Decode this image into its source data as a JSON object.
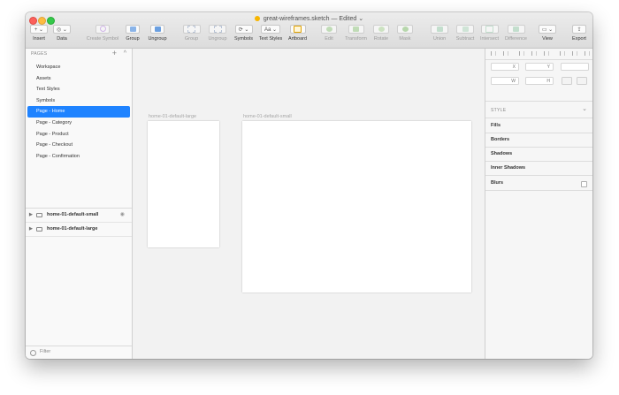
{
  "window": {
    "title": "great-wireframes.sketch — Edited",
    "title_chevron": "⌄"
  },
  "toolbar": {
    "insert": {
      "label": "Insert",
      "icon": "plus-icon",
      "glyph": "+ ⌄"
    },
    "data": {
      "label": "Data",
      "icon": "data-icon",
      "glyph": "◎ ⌄"
    },
    "create_symbol": {
      "label": "Create Symbol",
      "icon": "create-symbol-icon"
    },
    "group": {
      "label": "Group",
      "icon": "group-icon"
    },
    "ungroup": {
      "label": "Ungroup",
      "icon": "ungroup-icon"
    },
    "group2": {
      "label": "Group",
      "icon": "group-icon"
    },
    "ungroup2": {
      "label": "Ungroup",
      "icon": "ungroup-icon"
    },
    "symbols": {
      "label": "Symbols",
      "icon": "symbols-icon",
      "glyph": "⟳ ⌄"
    },
    "text_styles": {
      "label": "Text Styles",
      "icon": "text-styles-icon",
      "glyph": "Aa ⌄"
    },
    "artboard": {
      "label": "Artboard",
      "icon": "artboard-icon"
    },
    "edit": {
      "label": "Edit",
      "icon": "edit-icon"
    },
    "transform": {
      "label": "Transform",
      "icon": "transform-icon"
    },
    "rotate": {
      "label": "Rotate",
      "icon": "rotate-icon"
    },
    "mask": {
      "label": "Mask",
      "icon": "mask-icon"
    },
    "union": {
      "label": "Union",
      "icon": "union-icon"
    },
    "subtract": {
      "label": "Subtract",
      "icon": "subtract-icon"
    },
    "intersect": {
      "label": "Intersect",
      "icon": "intersect-icon"
    },
    "difference": {
      "label": "Difference",
      "icon": "difference-icon"
    },
    "view": {
      "label": "View",
      "icon": "view-icon",
      "glyph": "▭ ⌄"
    },
    "export": {
      "label": "Export",
      "icon": "share-icon",
      "glyph": "⇪"
    }
  },
  "pages": {
    "header": "PAGES",
    "add_glyph": "+",
    "collapse_glyph": "^",
    "items": [
      {
        "label": "Workspace"
      },
      {
        "label": "Assets"
      },
      {
        "label": "Text Styles"
      },
      {
        "label": "Symbols"
      },
      {
        "label": "Page - Home",
        "selected": true
      },
      {
        "label": "Page - Category"
      },
      {
        "label": "Page - Product"
      },
      {
        "label": "Page - Checkout"
      },
      {
        "label": "Page - Confirmation"
      }
    ]
  },
  "layers": [
    {
      "name": "home-01-default-small",
      "expander": "▶",
      "eye_glyph": "◉"
    },
    {
      "name": "home-01-default-large",
      "expander": "▶"
    }
  ],
  "filter": {
    "label": "Filter"
  },
  "canvas": {
    "artboards": [
      {
        "label": "home-01-default-large"
      },
      {
        "label": "home-01-default-small"
      }
    ]
  },
  "inspector": {
    "x_label": "X",
    "y_label": "Y",
    "w_label": "W",
    "h_label": "H",
    "style_header": "STYLE",
    "style_toggle": "⌄",
    "sections": [
      "Fills",
      "Borders",
      "Shadows",
      "Inner Shadows",
      "Blurs"
    ]
  },
  "colors": {
    "selection": "#1f83ff",
    "accent_icon_gray": "#a9a9a9",
    "doc_icon": "#f7b500"
  }
}
